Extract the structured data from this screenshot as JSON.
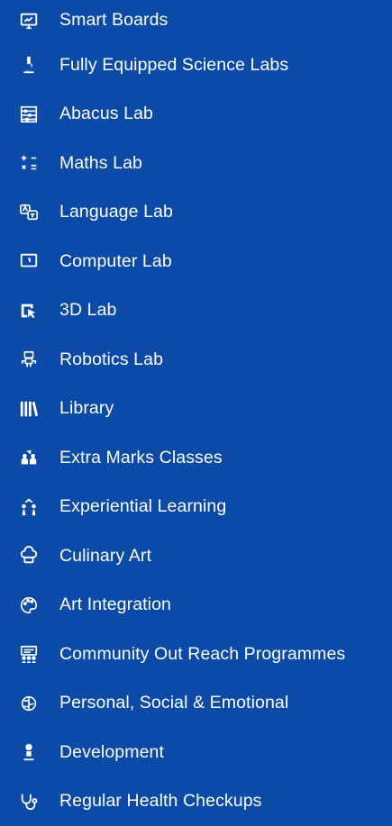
{
  "items": [
    {
      "label": "Smart Boards",
      "icon": "smart-board-icon"
    },
    {
      "label": "Fully Equipped Science Labs",
      "icon": "microscope-icon"
    },
    {
      "label": "Abacus Lab",
      "icon": "abacus-icon"
    },
    {
      "label": "Maths Lab",
      "icon": "math-symbols-icon"
    },
    {
      "label": "Language Lab",
      "icon": "translate-icon"
    },
    {
      "label": "Computer Lab",
      "icon": "monitor-icon"
    },
    {
      "label": "3D Lab",
      "icon": "cube-cursor-icon"
    },
    {
      "label": "Robotics Lab",
      "icon": "robot-icon"
    },
    {
      "label": "Library",
      "icon": "books-icon"
    },
    {
      "label": "Extra Marks Classes",
      "icon": "students-icon"
    },
    {
      "label": "Experiential Learning",
      "icon": "people-stars-icon"
    },
    {
      "label": "Culinary Art",
      "icon": "chef-hat-icon"
    },
    {
      "label": "Art Integration",
      "icon": "art-palette-icon"
    },
    {
      "label": "Community Out Reach Programmes",
      "icon": "community-board-icon"
    },
    {
      "label": "Personal, Social & Emotional",
      "icon": "brain-icon"
    },
    {
      "label": "Development",
      "icon": "growth-person-icon"
    },
    {
      "label": "Regular Health Checkups",
      "icon": "stethoscope-icon"
    }
  ],
  "colors": {
    "background": "#0b4aa6",
    "text": "#ffffff"
  }
}
